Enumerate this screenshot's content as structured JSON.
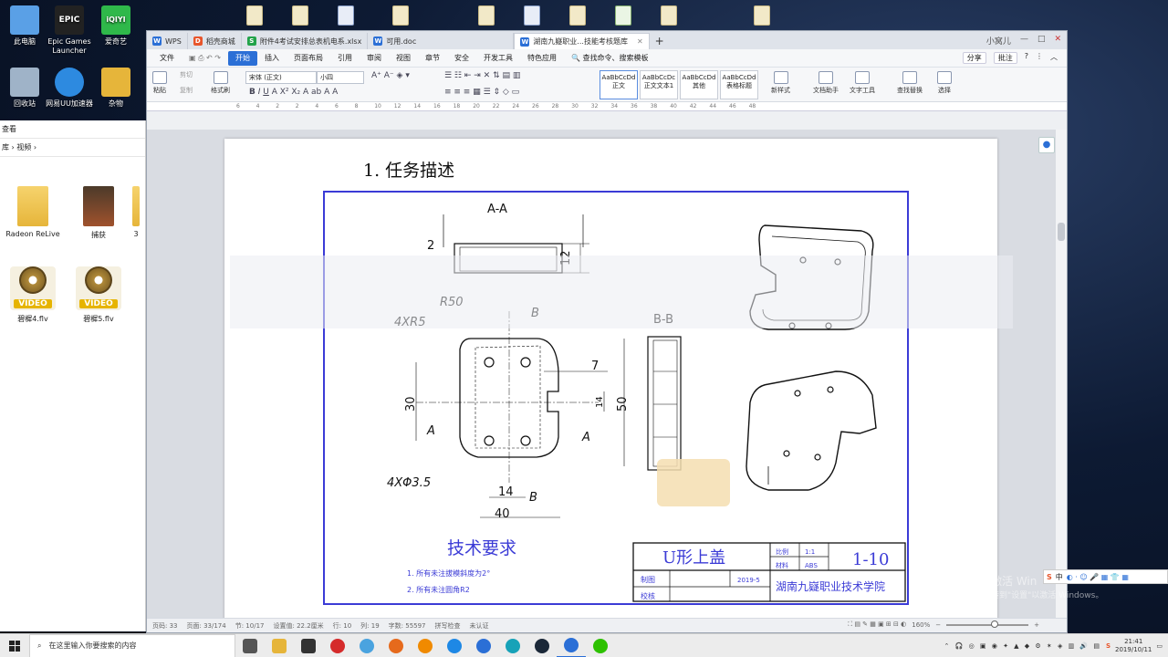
{
  "desktop": {
    "icons": [
      {
        "label": "此电脑",
        "color": "#5aa0e6"
      },
      {
        "label": "Epic Games Launcher",
        "color": "#222222",
        "badge": "EPIC"
      },
      {
        "label": "爱奇艺",
        "color": "#2fb84a",
        "badge": "iQIYI"
      },
      {
        "label": "回收站",
        "color": "#9fb3c8"
      },
      {
        "label": "网易UU加速器",
        "color": "#2d8ae0"
      },
      {
        "label": "杂物",
        "color": "#e6b53a"
      }
    ]
  },
  "explorer": {
    "header": "查看",
    "breadcrumb": "库 › 视频 ›",
    "items": [
      {
        "label": "Radeon ReLive",
        "kind": "folder"
      },
      {
        "label": "捕获",
        "kind": "folder-dark"
      },
      {
        "label": "3",
        "kind": "partial"
      },
      {
        "label": "碧樨4.flv",
        "kind": "video"
      },
      {
        "label": "碧樨5.flv",
        "kind": "video"
      }
    ],
    "video_tag": "VIDEO"
  },
  "wps": {
    "tabs": [
      {
        "label": "WPS",
        "badge": "W",
        "color": "#2b6fd6"
      },
      {
        "label": "稻壳商城",
        "badge": "D",
        "color": "#e8552b"
      },
      {
        "label": "附件4考试安排总表机电系.xlsx",
        "badge": "S",
        "color": "#23a34a"
      },
      {
        "label": "可用.doc",
        "badge": "W",
        "color": "#2b6fd6"
      },
      {
        "label": "湖南九嶷职业...技能考核题库",
        "badge": "W",
        "color": "#2b6fd6",
        "active": true
      }
    ],
    "user": "小窝儿",
    "menu": [
      "文件",
      "开始",
      "插入",
      "页面布局",
      "引用",
      "审阅",
      "视图",
      "章节",
      "安全",
      "开发工具",
      "特色应用",
      "查找命令、搜索模板"
    ],
    "menu_active": "开始",
    "share": "分享",
    "comment": "批注",
    "ribbon": {
      "paste": "粘贴",
      "cut": "剪切",
      "copy": "复制",
      "format_painter": "格式刷",
      "font_name": "宋体 (正文)",
      "font_size": "小四",
      "styles": [
        {
          "sample": "AaBbCcDd",
          "label": "正文"
        },
        {
          "sample": "AaBbCcDc",
          "label": "正文文本1"
        },
        {
          "sample": "AaBbCcDd",
          "label": "其他"
        },
        {
          "sample": "AaBbCcDd",
          "label": "表格标题"
        }
      ],
      "new_style": "新样式",
      "doc_helper": "文档助手",
      "text_tools": "文字工具",
      "find_replace": "查找替换",
      "select": "选择"
    },
    "ruler_marks": [
      "6",
      "4",
      "2",
      "2",
      "4",
      "6",
      "8",
      "10",
      "12",
      "14",
      "16",
      "18",
      "20",
      "22",
      "24",
      "26",
      "28",
      "30",
      "32",
      "34",
      "36",
      "38",
      "40",
      "42",
      "44",
      "46",
      "48"
    ],
    "document": {
      "heading": "1. 任务描述",
      "drawing": {
        "section_aa": "A-A",
        "section_bb": "B-B",
        "dim_2": "2",
        "dim_12": "12",
        "r50": "R50",
        "r5": "4XR5",
        "b_top": "B",
        "b_bottom": "B",
        "a_left": "A",
        "a_right": "A",
        "dim_30": "30",
        "dim_7": "7",
        "dim_14v": "14",
        "dim_50": "50",
        "dim_14h": "14",
        "dim_40": "40",
        "holes": "4XΦ3.5",
        "tech_title": "技术要求",
        "tech_notes": [
          "1. 所有未注拔模斜度为2°",
          "2. 所有未注圆角R2"
        ],
        "title_block": {
          "part_name": "U形上盖",
          "scale_label": "比例",
          "scale": "1:1",
          "material_label": "材料",
          "material": "ABS",
          "number": "1-10",
          "drafter_label": "制图",
          "date": "2019-5",
          "checker_label": "校核",
          "school": "湖南九嶷职业技术学院"
        }
      }
    },
    "status": {
      "page": "页码: 33",
      "pages": "页面: 33/174",
      "section": "节: 10/17",
      "position": "设置值: 22.2厘米",
      "row": "行: 10",
      "col": "列: 19",
      "words": "字数: 55597",
      "spell": "拼写检查",
      "unsaved": "未认证",
      "zoom": "160%",
      "zoom_level": 0.6
    }
  },
  "taskbar": {
    "search_placeholder": "在这里输入你要搜索的内容",
    "apps": [
      {
        "name": "task-view",
        "color": "#555555"
      },
      {
        "name": "file-explorer",
        "color": "#e6b53a"
      },
      {
        "name": "calculator",
        "color": "#333333"
      },
      {
        "name": "netease-music",
        "color": "#d52b2b"
      },
      {
        "name": "app-color",
        "color": "#4aa3df"
      },
      {
        "name": "firefox",
        "color": "#e66a1c"
      },
      {
        "name": "browser-orange",
        "color": "#f08a00"
      },
      {
        "name": "app-blue",
        "color": "#1e88e5"
      },
      {
        "name": "wps",
        "color": "#2b6fd6"
      },
      {
        "name": "app-cyan",
        "color": "#17a2b8"
      },
      {
        "name": "steam",
        "color": "#1b2838"
      },
      {
        "name": "wps-running",
        "color": "#2b6fd6"
      },
      {
        "name": "wechat",
        "color": "#2dc100"
      }
    ],
    "time": "21:41",
    "date": "2019/10/11",
    "ime": "中"
  },
  "watermark": {
    "line1": "激活 Win",
    "line2": "转到\"设置\"以激活 Windows。"
  }
}
